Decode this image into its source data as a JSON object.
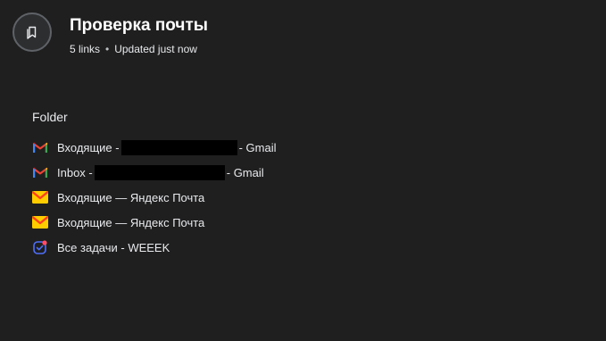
{
  "collection": {
    "title": "Проверка почты",
    "count": "5 links",
    "updated": "Updated just now",
    "separator": "•"
  },
  "folder": {
    "label": "Folder"
  },
  "links": [
    {
      "icon": "gmail-icon",
      "prefix": "Входящие -",
      "suffix": "- Gmail"
    },
    {
      "icon": "gmail-icon",
      "prefix": "Inbox -",
      "suffix": "- Gmail"
    },
    {
      "icon": "yandex-mail-icon",
      "label": "Входящие — Яндекс Почта"
    },
    {
      "icon": "yandex-mail-icon",
      "label": "Входящие — Яндекс Почта"
    },
    {
      "icon": "weeek-icon",
      "label": "Все задачи - WEEEK"
    }
  ],
  "colors": {
    "background": "#1f1f1f",
    "gmail_red": "#ea4335",
    "yandex_yellow": "#fc3f1d",
    "weeek_blue": "#4f6ff7"
  }
}
